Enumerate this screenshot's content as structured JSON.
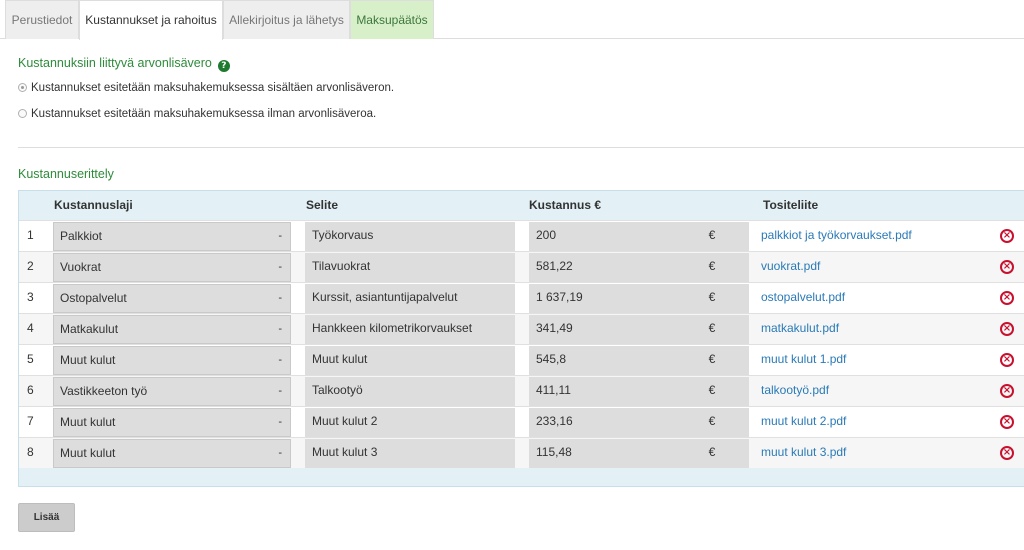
{
  "tabs": [
    {
      "label": "Perustiedot"
    },
    {
      "label": "Kustannukset ja rahoitus"
    },
    {
      "label": "Allekirjoitus ja lähetys"
    },
    {
      "label": "Maksupäätös"
    }
  ],
  "vat": {
    "title": "Kustannuksiin liittyvä arvonlisävero",
    "help_icon": "?",
    "options": [
      {
        "label": "Kustannukset esitetään maksuhakemuksessa sisältäen arvonlisäveron.",
        "checked": true
      },
      {
        "label": "Kustannukset esitetään maksuhakemuksessa ilman arvonlisäveroa.",
        "checked": false
      }
    ]
  },
  "breakdown": {
    "title": "Kustannuserittely",
    "headers": {
      "type": "Kustannuslaji",
      "description": "Selite",
      "cost": "Kustannus €",
      "attachment": "Tositeliite"
    },
    "rows": [
      {
        "num": "1",
        "type": "Palkkiot",
        "description": "Työkorvaus",
        "cost": "200",
        "currency": "€",
        "attachment": "palkkiot ja työkorvaukset.pdf"
      },
      {
        "num": "2",
        "type": "Vuokrat",
        "description": "Tilavuokrat",
        "cost": "581,22",
        "currency": "€",
        "attachment": "vuokrat.pdf"
      },
      {
        "num": "3",
        "type": "Ostopalvelut",
        "description": "Kurssit, asiantuntijapalvelut",
        "cost": "1 637,19",
        "currency": "€",
        "attachment": "ostopalvelut.pdf"
      },
      {
        "num": "4",
        "type": "Matkakulut",
        "description": "Hankkeen kilometrikorvaukset",
        "cost": "341,49",
        "currency": "€",
        "attachment": "matkakulut.pdf"
      },
      {
        "num": "5",
        "type": "Muut kulut",
        "description": "Muut kulut",
        "cost": "545,8",
        "currency": "€",
        "attachment": "muut kulut 1.pdf"
      },
      {
        "num": "6",
        "type": "Vastikkeeton työ",
        "description": "Talkootyö",
        "cost": "411,11",
        "currency": "€",
        "attachment": "talkootyö.pdf"
      },
      {
        "num": "7",
        "type": "Muut kulut",
        "description": "Muut kulut 2",
        "cost": "233,16",
        "currency": "€",
        "attachment": "muut kulut 2.pdf"
      },
      {
        "num": "8",
        "type": "Muut kulut",
        "description": "Muut kulut 3",
        "cost": "115,48",
        "currency": "€",
        "attachment": "muut kulut 3.pdf"
      }
    ],
    "select_caret": "-",
    "delete_icon": "×",
    "add_label": "Lisää"
  }
}
